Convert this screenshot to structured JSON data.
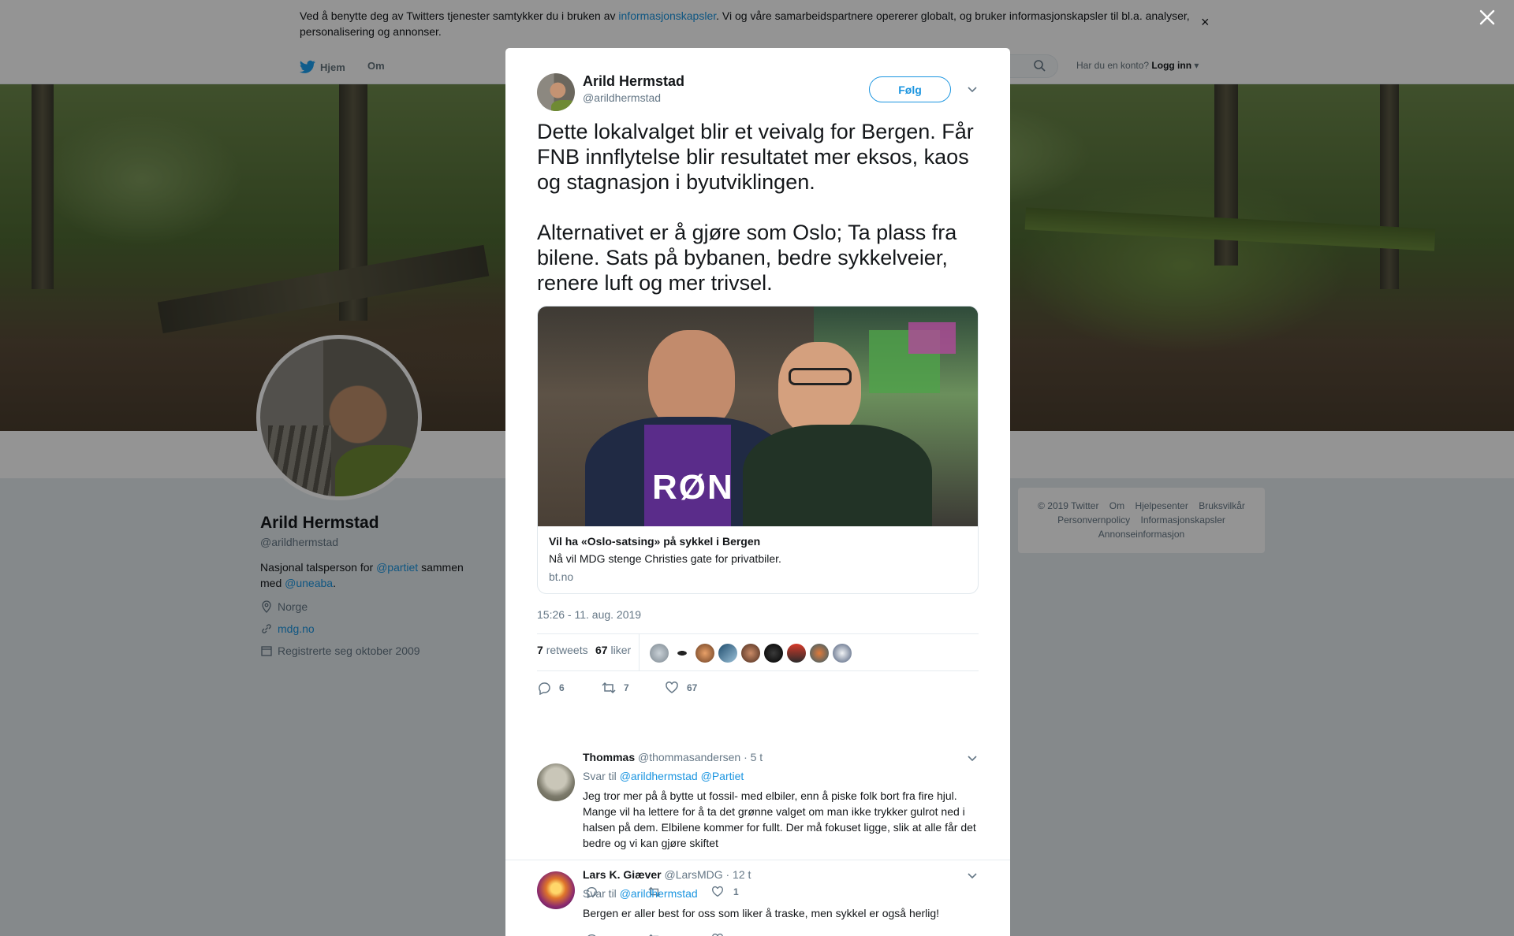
{
  "cookie": {
    "text_before": "Ved å benytte deg av Twitters tjenester samtykker du i bruken av ",
    "link": "informasjonskapsler",
    "text_after": ". Vi og våre samarbeidspartnere opererer globalt, og bruker informasjonskapsler til bl.a. analyser, personalisering og annonser.",
    "close": "×"
  },
  "nav": {
    "home": "Hjem",
    "about": "Om",
    "have_account": "Har du en konto?",
    "login": "Logg inn"
  },
  "profile": {
    "name": "Arild Hermstad",
    "handle": "@arildhermstad",
    "bio_1": "Nasjonal talsperson for ",
    "bio_link_1": "@partiet",
    "bio_2": " sammen med ",
    "bio_link_2": "@uneaba",
    "bio_3": ".",
    "location": "Norge",
    "website": "mdg.no",
    "joined": "Registrerte seg oktober 2009"
  },
  "footer": {
    "items": [
      "© 2019 Twitter",
      "Om",
      "Hjelpesenter",
      "Bruksvilkår",
      "Personvernpolicy",
      "Informasjonskapsler",
      "Annonseinformasjon"
    ]
  },
  "tweet": {
    "author_name": "Arild Hermstad",
    "author_handle": "@arildhermstad",
    "follow_label": "Følg",
    "text": "Dette lokalvalget blir et veivalg for Bergen. Får FNB innflytelse blir resultatet mer eksos, kaos og stagnasjon i byutviklingen.\n\nAlternativet er å gjøre som Oslo; Ta plass fra bilene. Sats på bybanen, bedre sykkelveier, renere luft og mer trivsel.",
    "card": {
      "title": "Vil ha «Oslo-satsing» på sykkel i Bergen",
      "description": "Nå vil MDG stenge Christies gate for privatbiler.",
      "domain": "bt.no",
      "shirt_text": "RØN"
    },
    "timestamp": "15:26 - 11. aug. 2019",
    "retweets_count": "7",
    "retweets_label": "retweets",
    "likes_count": "67",
    "likes_label": "liker",
    "action_replies": "6",
    "action_retweets": "7",
    "action_likes": "67"
  },
  "replies": [
    {
      "name": "Thommas",
      "handle": "@thommasandersen",
      "time": "· 5 t",
      "reply_to_label": "Svar til ",
      "reply_to": "@arildhermstad @Partiet",
      "text": "Jeg tror mer på å bytte ut fossil- med elbiler, enn å piske folk bort fra fire hjul. Mange vil ha lettere for å ta det grønne valget om man ikke trykker gulrot ned i halsen på dem. Elbilene kommer for fullt. Der må fokuset ligge, slik at alle får det bedre og vi kan gjøre skiftet",
      "likes": "1"
    },
    {
      "name": "Lars K. Giæver",
      "handle": "@LarsMDG",
      "time": "· 12 t",
      "reply_to_label": "Svar til ",
      "reply_to": "@arildhermstad",
      "text": "Bergen er aller best for oss som liker å traske, men sykkel er også herlig!"
    }
  ],
  "colors": {
    "link": "#1b95e0",
    "text": "#14171a",
    "muted": "#657786",
    "bg": "#e6ecf0"
  }
}
